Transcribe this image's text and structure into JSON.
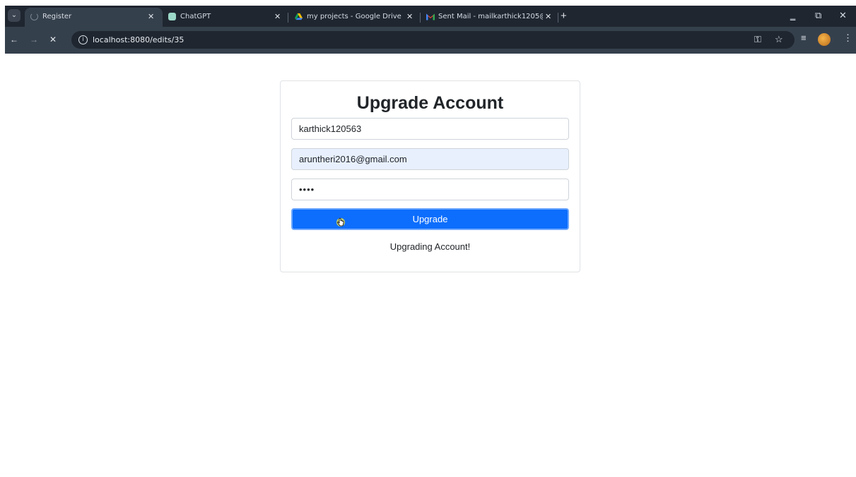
{
  "browser": {
    "tabs": [
      {
        "title": "Register",
        "icon": "loading-spinner-icon",
        "active": true
      },
      {
        "title": "ChatGPT",
        "icon": "chatgpt-icon",
        "active": false
      },
      {
        "title": "my projects - Google Drive",
        "icon": "google-drive-icon",
        "active": false
      },
      {
        "title": "Sent Mail - mailkarthick1205@",
        "icon": "gmail-icon",
        "active": false
      }
    ],
    "url": "localhost:8080/edits/35"
  },
  "form": {
    "title": "Upgrade Account",
    "username_value": "karthick120563",
    "email_value": "aruntheri2016@gmail.com",
    "password_value": "••••",
    "submit_label": "Upgrade",
    "status_message": "Upgrading Account!"
  },
  "colors": {
    "primary_button": "#0d6efd",
    "autofill_background": "#e8f0fe",
    "browser_frame": "#1f2630",
    "browser_toolbar": "#35404d"
  }
}
